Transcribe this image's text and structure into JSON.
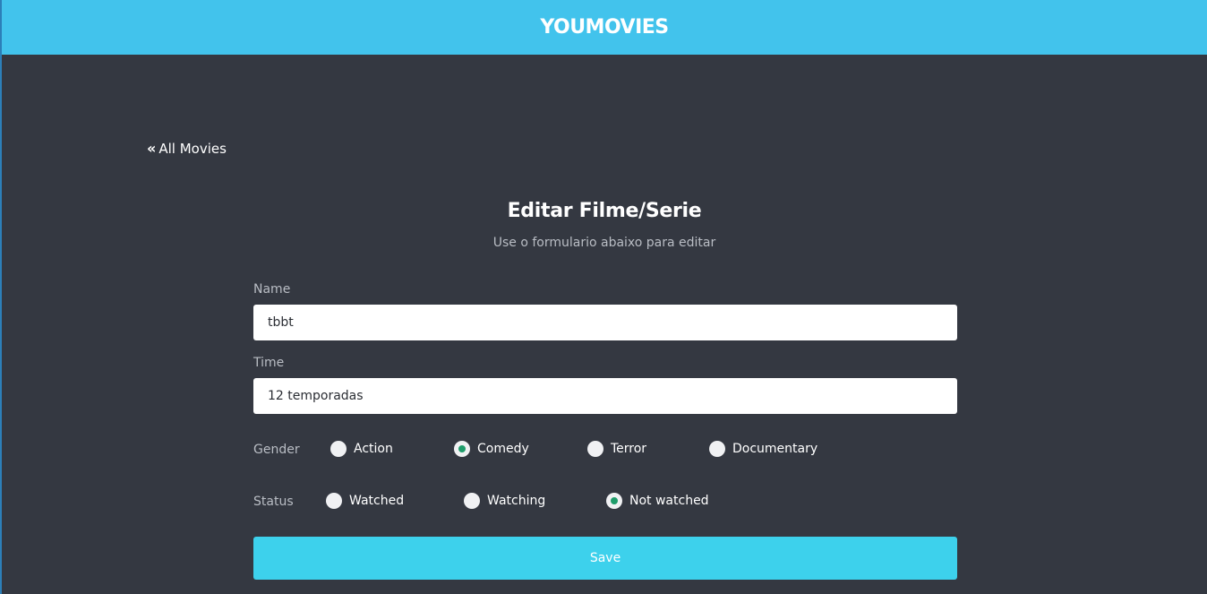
{
  "header": {
    "brand": "YOUMOVIES"
  },
  "nav": {
    "back_icon": "«",
    "back_label": "All Movies"
  },
  "form": {
    "title": "Editar Filme/Serie",
    "subtitle": "Use o formulario abaixo para editar",
    "name": {
      "label": "Name",
      "value": "tbbt"
    },
    "time": {
      "label": "Time",
      "value": "12 temporadas"
    },
    "gender": {
      "label": "Gender",
      "options": [
        {
          "label": "Action",
          "checked": false
        },
        {
          "label": "Comedy",
          "checked": true
        },
        {
          "label": "Terror",
          "checked": false
        },
        {
          "label": "Documentary",
          "checked": false
        }
      ]
    },
    "status": {
      "label": "Status",
      "options": [
        {
          "label": "Watched",
          "checked": false
        },
        {
          "label": "Watching",
          "checked": false
        },
        {
          "label": "Not watched",
          "checked": true
        }
      ]
    },
    "save_label": "Save"
  },
  "colors": {
    "header_bg": "#42c3ec",
    "page_bg": "#343841",
    "button_bg": "#3dd1ec",
    "radio_checked": "#1f9d6b"
  }
}
